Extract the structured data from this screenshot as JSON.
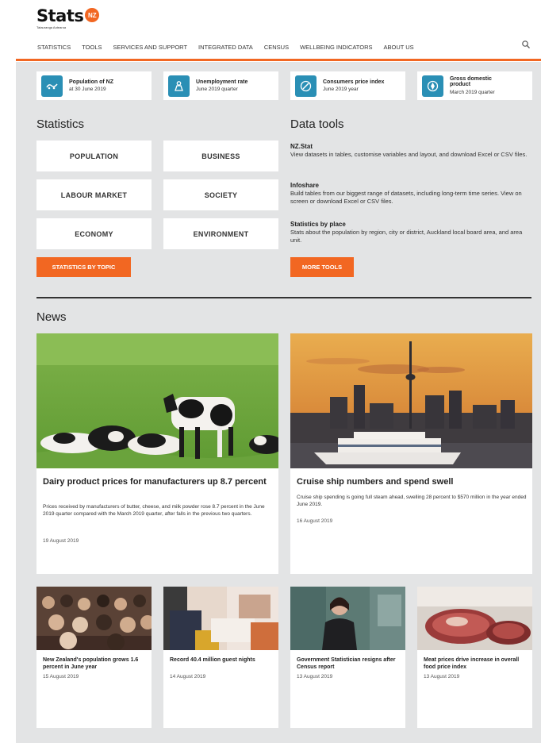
{
  "header": {
    "logo_text": "Stats",
    "logo_badge": "NZ",
    "logo_subtitle": "Tatauranga Aotearoa",
    "nav": [
      "STATISTICS",
      "TOOLS",
      "SERVICES AND SUPPORT",
      "INTEGRATED DATA",
      "CENSUS",
      "WELLBEING INDICATORS",
      "ABOUT US"
    ]
  },
  "tiles": [
    {
      "title": "Population of NZ",
      "sub": "at 30 June 2019",
      "icon": "population-icon"
    },
    {
      "title": "Unemployment rate",
      "sub": "June 2019 quarter",
      "icon": "unemployment-icon"
    },
    {
      "title": "Consumers price index",
      "sub": "June 2019 year",
      "icon": "cpi-icon"
    },
    {
      "title": "Gross domestic product",
      "sub": "March 2019 quarter",
      "icon": "gdp-icon"
    }
  ],
  "statistics": {
    "heading": "Statistics",
    "categories": [
      "POPULATION",
      "BUSINESS",
      "LABOUR MARKET",
      "SOCIETY",
      "ECONOMY",
      "ENVIRONMENT"
    ],
    "button": "STATISTICS BY TOPIC"
  },
  "data_tools": {
    "heading": "Data tools",
    "tools": [
      {
        "title": "NZ.Stat",
        "desc": "View datasets in tables, customise variables and layout, and download Excel or CSV files."
      },
      {
        "title": "Infoshare",
        "desc": "Build tables from our biggest range of datasets, including long-term time series. View on screen or download Excel or CSV files."
      },
      {
        "title": "Statistics by place",
        "desc": "Stats about the population by region, city or district, Auckland local board area, and area unit."
      }
    ],
    "button": "MORE TOOLS"
  },
  "news": {
    "heading": "News",
    "featured": [
      {
        "title": "Dairy product prices for manufacturers up 8.7 percent",
        "desc": "Prices received by manufacturers of butter, cheese, and milk powder rose 8.7 percent in the June 2019 quarter compared with the March 2019 quarter, after falls in the previous two quarters.",
        "date": "19 August 2019"
      },
      {
        "title": "Cruise ship numbers and spend swell",
        "desc": "Cruise ship spending is going full steam ahead, swelling 28 percent to $570 million in the year ended June 2019.",
        "date": "16 August 2019"
      }
    ],
    "small": [
      {
        "title": "New Zealand's population grows 1.6 percent in June year",
        "date": "15 August 2019"
      },
      {
        "title": "Record 40.4 million guest nights",
        "date": "14 August 2019"
      },
      {
        "title": "Government Statistician resigns after Census report",
        "date": "13 August 2019"
      },
      {
        "title": "Meat prices drive increase in overall food price index",
        "date": "13 August 2019"
      }
    ]
  },
  "colors": {
    "accent": "#f26722",
    "icon_blue": "#2a8fb5",
    "background": "#e3e4e5"
  }
}
